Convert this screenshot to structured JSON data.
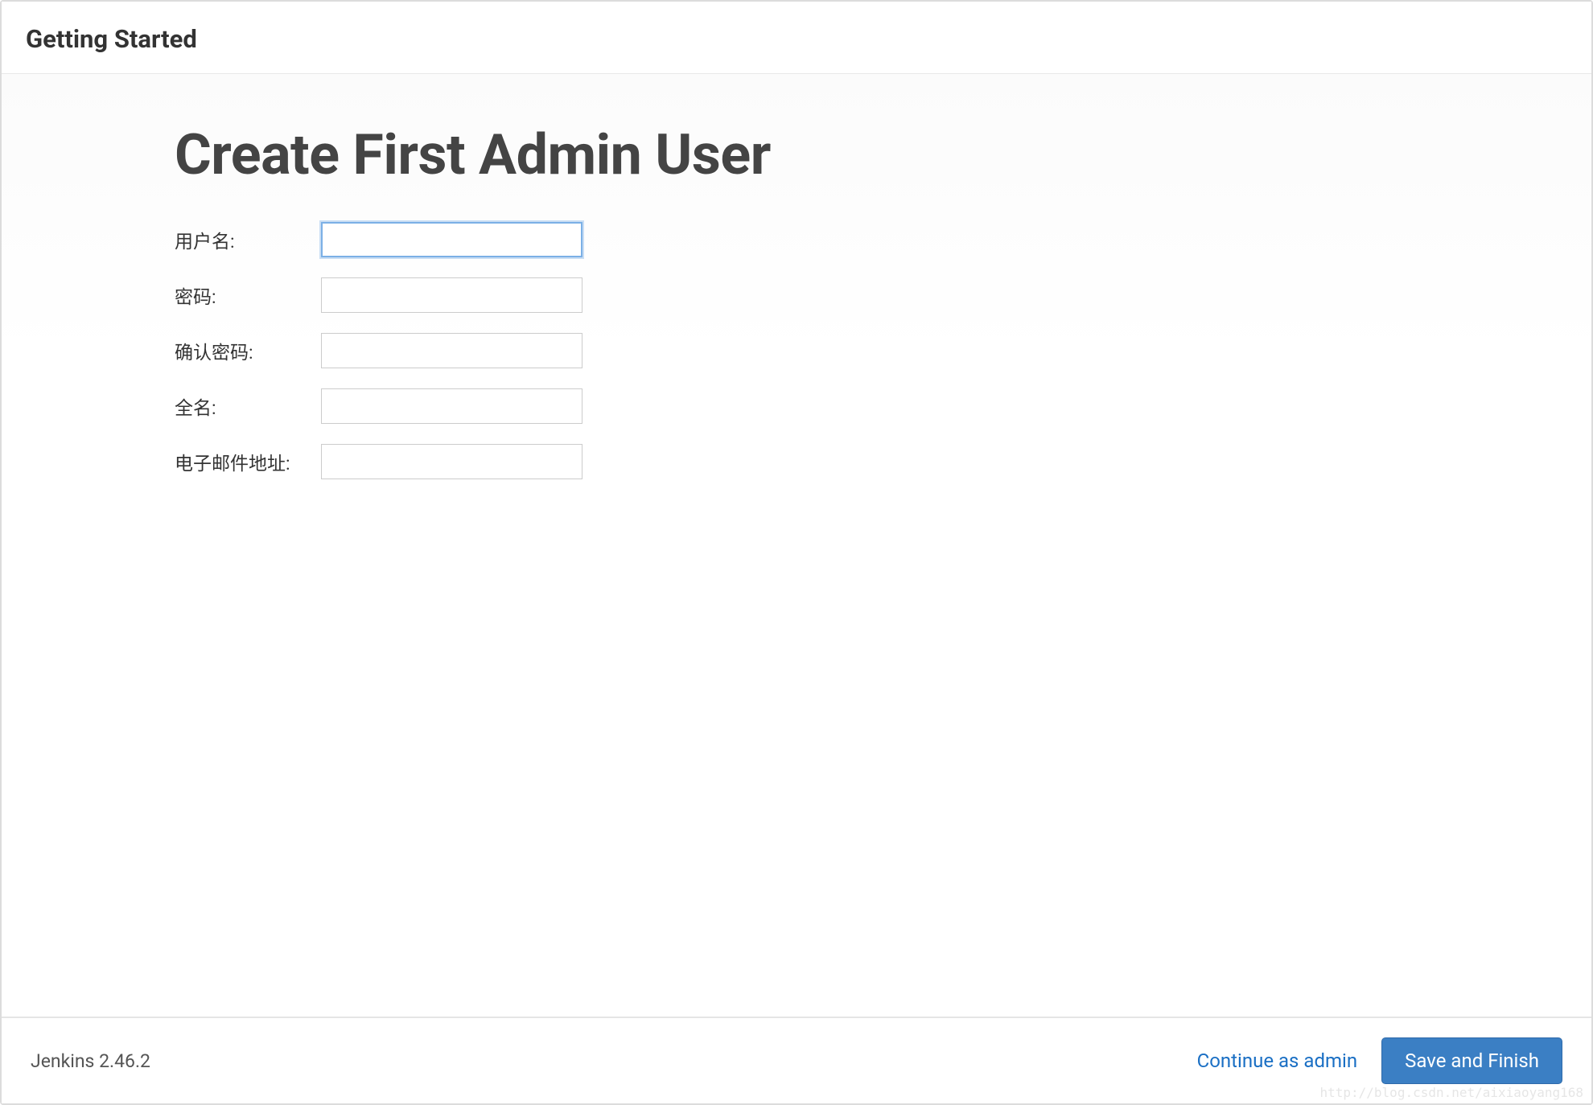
{
  "header": {
    "title": "Getting Started"
  },
  "main": {
    "title": "Create First Admin User",
    "fields": {
      "username": {
        "label": "用户名:",
        "value": ""
      },
      "password": {
        "label": "密码:",
        "value": ""
      },
      "confirm_password": {
        "label": "确认密码:",
        "value": ""
      },
      "fullname": {
        "label": "全名:",
        "value": ""
      },
      "email": {
        "label": "电子邮件地址:",
        "value": ""
      }
    }
  },
  "footer": {
    "version": "Jenkins 2.46.2",
    "continue_label": "Continue as admin",
    "save_label": "Save and Finish"
  },
  "watermark": "http://blog.csdn.net/aixiaoyang168"
}
